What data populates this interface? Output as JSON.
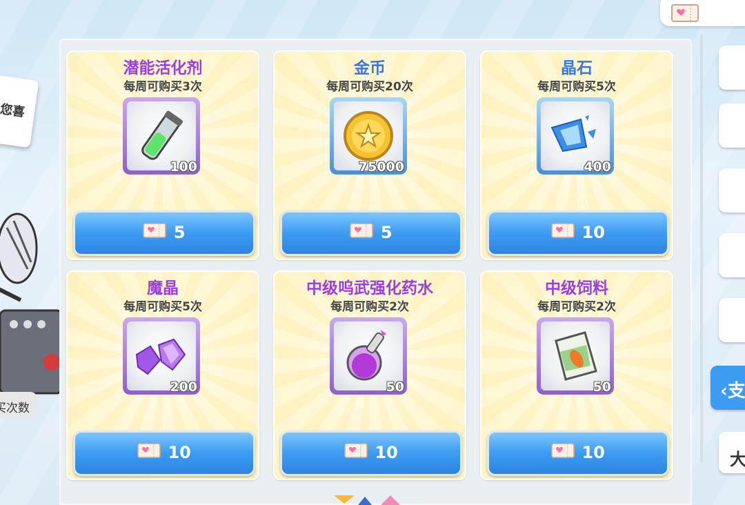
{
  "currency": {
    "icon": "ticket-icon"
  },
  "left_note": {
    "text": "您喜"
  },
  "left_count": {
    "text": "买次数"
  },
  "items": [
    {
      "name": "潜能活化剂",
      "limit": "每周可购买3次",
      "qty": "100",
      "price": "5",
      "frame": "purple",
      "icon": "potion-vial-icon"
    },
    {
      "name": "金币",
      "limit": "每周可购买20次",
      "qty": "75000",
      "price": "5",
      "frame": "blue",
      "icon": "gold-coin-icon"
    },
    {
      "name": "晶石",
      "limit": "每周可购买5次",
      "qty": "400",
      "price": "10",
      "frame": "blue",
      "icon": "crystal-shard-icon"
    },
    {
      "name": "魔晶",
      "limit": "每周可购买5次",
      "qty": "200",
      "price": "10",
      "frame": "purple",
      "icon": "magic-crystal-icon"
    },
    {
      "name": "中级呜武强化药水",
      "limit": "每周可购买2次",
      "qty": "50",
      "price": "10",
      "frame": "purple",
      "icon": "flask-icon"
    },
    {
      "name": "中级饲料",
      "limit": "每周可购买2次",
      "qty": "50",
      "price": "10",
      "frame": "purple",
      "icon": "feed-bag-icon"
    }
  ],
  "sidebar": {
    "active_label": "‹支",
    "last_label": "大"
  },
  "colors": {
    "purple_title": "#9a3ee0",
    "blue_title": "#3a78d8",
    "button_blue": "#3d9bf0"
  }
}
